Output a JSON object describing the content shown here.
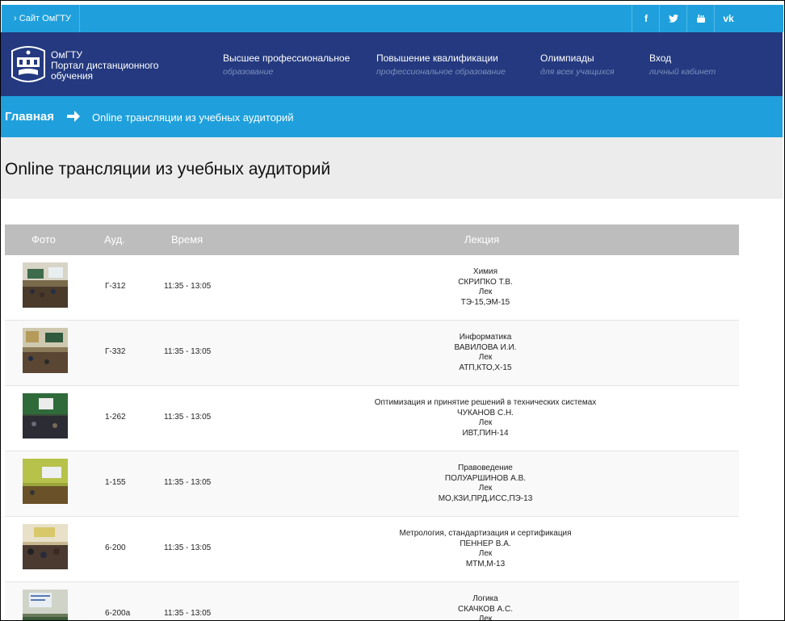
{
  "topbar": {
    "site_link": "› Сайт ОмГТУ",
    "social": [
      {
        "icon": "facebook-icon",
        "glyph": "f"
      },
      {
        "icon": "twitter-icon",
        "glyph": "🐦"
      },
      {
        "icon": "youtube-icon",
        "glyph": "▶"
      },
      {
        "icon": "vk-icon",
        "glyph": "vk"
      }
    ]
  },
  "header": {
    "logo_line1": "ОмГТУ",
    "logo_line2": "Портал дистанционного",
    "logo_line3": "обучения",
    "nav": [
      {
        "label": "Высшее профессиональное",
        "sub": "образование"
      },
      {
        "label": "Повышение квалификации",
        "sub": "профессиональное образование"
      },
      {
        "label": "Олимпиады",
        "sub": "для всех учащихся"
      },
      {
        "label": "Вход",
        "sub": "личный кабинет"
      }
    ]
  },
  "breadcrumb": {
    "home": "Главная",
    "current": "Online трансляции из учебных аудиторий"
  },
  "page_title": "Online трансляции из учебных аудиторий",
  "table": {
    "headers": {
      "photo": "Фото",
      "aud": "Ауд.",
      "time": "Время",
      "lecture": "Лекция"
    },
    "rows": [
      {
        "aud": "Г-312",
        "time": "11:35 - 13:05",
        "lecture": [
          "Химия",
          "СКРИПКО Т.В.",
          "Лек",
          "ТЭ-15,ЭМ-15"
        ]
      },
      {
        "aud": "Г-332",
        "time": "11:35 - 13:05",
        "lecture": [
          "Информатика",
          "ВАВИЛОВА И.И.",
          "Лек",
          "АТП,КТО,Х-15"
        ]
      },
      {
        "aud": "1-262",
        "time": "11:35 - 13:05",
        "lecture": [
          "Оптимизация и принятие решений в технических системах",
          "ЧУКАНОВ С.Н.",
          "Лек",
          "ИВТ,ПИН-14"
        ]
      },
      {
        "aud": "1-155",
        "time": "11:35 - 13:05",
        "lecture": [
          "Правоведение",
          "ПОЛУАРШИНОВ А.В.",
          "Лек",
          "МО,КЗИ,ПРД,ИСС,ПЭ-13"
        ]
      },
      {
        "aud": "6-200",
        "time": "11:35 - 13:05",
        "lecture": [
          "Метрология, стандартизация и сертификация",
          "ПЕННЕР В.А.",
          "Лек",
          "МТМ,М-13"
        ]
      },
      {
        "aud": "6-200а",
        "time": "11:35 - 13:05",
        "lecture": [
          "Логика",
          "СКАЧКОВ А.С.",
          "Лек"
        ]
      }
    ]
  },
  "colors": {
    "topbar": "#1fa0dc",
    "header": "#24397f",
    "table_header": "#bdbdbd"
  }
}
